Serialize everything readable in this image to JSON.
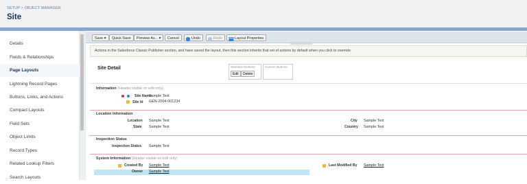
{
  "header": {
    "breadcrumb": "SETUP > OBJECT MANAGER",
    "title": "Site"
  },
  "sidebar": {
    "items": [
      {
        "label": "Details",
        "active": false
      },
      {
        "label": "Fields & Relationships",
        "active": false
      },
      {
        "label": "Page Layouts",
        "active": true
      },
      {
        "label": "Lightning Record Pages",
        "active": false
      },
      {
        "label": "Buttons, Links, and Actions",
        "active": false
      },
      {
        "label": "Compact Layouts",
        "active": false
      },
      {
        "label": "Field Sets",
        "active": false
      },
      {
        "label": "Object Limits",
        "active": false
      },
      {
        "label": "Record Types",
        "active": false
      },
      {
        "label": "Related Lookup Filters",
        "active": false
      },
      {
        "label": "Search Layouts",
        "active": false
      }
    ]
  },
  "toolbar": {
    "save": "Save ▾",
    "quick_save": "Quick Save",
    "preview": "Preview As... ▾",
    "cancel": "Cancel",
    "undo": "Undo",
    "redo": "Redo",
    "layout_props": "Layout Properties"
  },
  "info_text": "Actions in the Salesforce Classic Publisher section, and have saved the layout, then this section inherits that set of actions by default when you click to override",
  "detail": {
    "title": "Site Detail",
    "standard_buttons": "Standard Buttons",
    "custom_buttons": "Custom Buttons",
    "edit": "Edit",
    "delete": "Delete"
  },
  "sections": {
    "information": {
      "title": "Information",
      "note": "(Header visible on edit only)"
    },
    "location": {
      "title": "Location Information"
    },
    "inspection": {
      "title": "Inspection Status"
    },
    "system": {
      "title": "System Information",
      "note": "(Header visible on edit only)"
    }
  },
  "fields": {
    "site_name": {
      "label": "Site Name",
      "value": "Sample Text"
    },
    "site_id": {
      "label": "Site Id",
      "value": "GEN-2004-001234"
    },
    "location": {
      "label": "Location",
      "value": "Sample Text"
    },
    "state": {
      "label": "State",
      "value": "Sample Text"
    },
    "city": {
      "label": "City",
      "value": "Sample Text"
    },
    "country": {
      "label": "Country",
      "value": "Sample Text"
    },
    "inspection_status": {
      "label": "Inspection Status",
      "value": "Sample Text"
    },
    "created_by": {
      "label": "Created By",
      "value": "Sample Text"
    },
    "owner": {
      "label": "Owner",
      "value": "Sample Text"
    },
    "last_modified_by": {
      "label": "Last Modified By",
      "value": "Sample Text"
    }
  },
  "colors": {
    "accent": "#16325c",
    "section_rule": "#e4a6a6",
    "owner_highlight": "#bfe5f5"
  }
}
